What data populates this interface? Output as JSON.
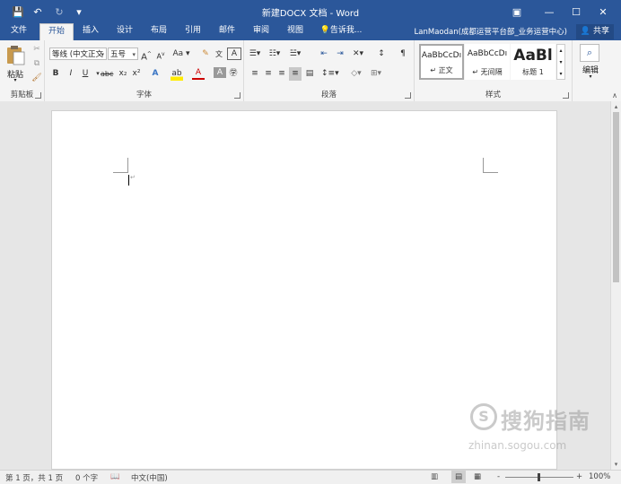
{
  "window": {
    "title": "新建DOCX 文档 - Word",
    "user": "LanMaodan(成都运营平台部_业务运营中心)",
    "share_label": "共享",
    "controls": {
      "ribbon_options": "▣",
      "minimize": "—",
      "maximize": "☐",
      "close": "✕"
    }
  },
  "quick_access": {
    "save": "💾",
    "undo": "↶",
    "redo": "↻",
    "customize": "▾"
  },
  "tabs": [
    {
      "label": "文件"
    },
    {
      "label": "开始"
    },
    {
      "label": "插入"
    },
    {
      "label": "设计"
    },
    {
      "label": "布局"
    },
    {
      "label": "引用"
    },
    {
      "label": "邮件"
    },
    {
      "label": "审阅"
    },
    {
      "label": "视图"
    },
    {
      "label": "告诉我..."
    }
  ],
  "active_tab": "开始",
  "ribbon": {
    "clipboard": {
      "label": "剪贴板",
      "paste_label": "粘贴"
    },
    "font": {
      "label": "字体",
      "font_name": "等线 (中文正文",
      "font_size": "五号",
      "grow": "A",
      "shrink": "A",
      "change_case": "Aa",
      "bold": "B",
      "italic": "I",
      "underline": "U",
      "strike": "abc",
      "subscript": "x₂",
      "superscript": "x²",
      "font_color": "A",
      "char_shading": "A",
      "highlight": "ab"
    },
    "paragraph": {
      "label": "段落"
    },
    "styles": {
      "label": "样式",
      "items": [
        {
          "sample": "AaBbCcDı",
          "name": "↵ 正文"
        },
        {
          "sample": "AaBbCcDı",
          "name": "↵ 无间隔"
        },
        {
          "sample": "AaBl",
          "name": "标题 1"
        }
      ]
    },
    "editing": {
      "label": "编辑"
    }
  },
  "statusbar": {
    "page": "第 1 页，共 1 页",
    "words": "0 个字",
    "language": "中文(中国)",
    "zoom": "100%",
    "zoom_minus": "-",
    "zoom_plus": "+"
  },
  "watermark": {
    "text": "搜狗指南",
    "url": "zhinan.sogou.com"
  }
}
